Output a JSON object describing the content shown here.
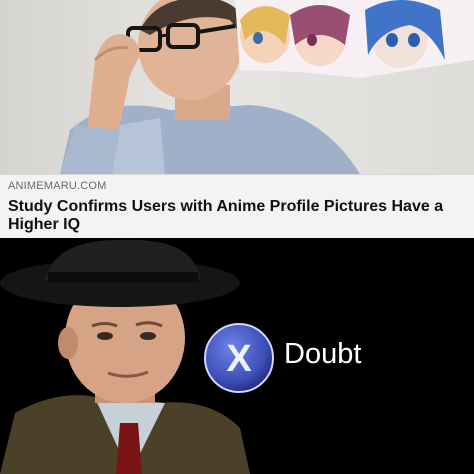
{
  "article": {
    "source": "ANIMEMARU.COM",
    "headline": "Study Confirms Users with Anime Profile Pictures Have a Higher IQ"
  },
  "reaction": {
    "label": "Doubt",
    "button_glyph": "X",
    "button_color": "#3d4fb8"
  },
  "icons": [
    "x-button-icon"
  ],
  "colors": {
    "caption_bg": "#f3f3f3",
    "bottom_bg": "#000000"
  }
}
